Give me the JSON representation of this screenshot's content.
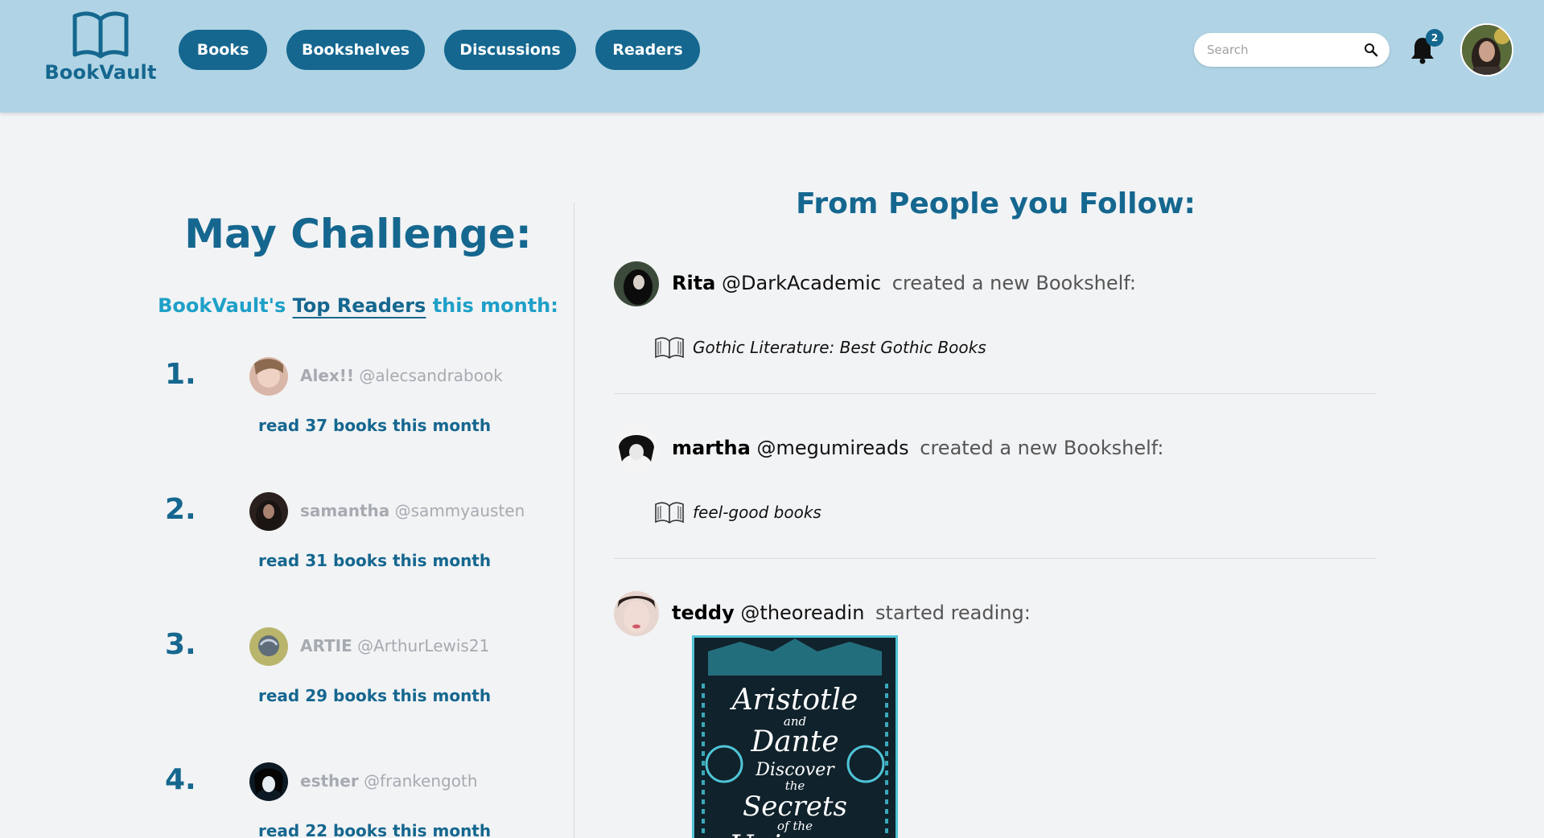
{
  "app": {
    "name": "BookVault",
    "colors": {
      "header_bg": "#b0d4e5",
      "primary": "#15678f",
      "accent": "#1ea0c8",
      "page_bg": "#f2f3f5"
    }
  },
  "nav": {
    "items": [
      {
        "label": "Books"
      },
      {
        "label": "Bookshelves"
      },
      {
        "label": "Discussions"
      },
      {
        "label": "Readers"
      }
    ]
  },
  "search": {
    "placeholder": "Search",
    "value": ""
  },
  "notifications": {
    "count": "2"
  },
  "challenge": {
    "title": "May Challenge:",
    "subtitle_prefix": "BookVault's",
    "subtitle_link": "Top Readers",
    "subtitle_suffix": "this month:",
    "rankings": [
      {
        "rank": "1.",
        "name": "Alex!!",
        "handle": "@alecsandrabook",
        "read_text": "read 37 books this month"
      },
      {
        "rank": "2.",
        "name": "samantha",
        "handle": "@sammyausten",
        "read_text": "read 31 books this month"
      },
      {
        "rank": "3.",
        "name": "ARTIE",
        "handle": "@ArthurLewis21",
        "read_text": "read 29 books this month"
      },
      {
        "rank": "4.",
        "name": "esther",
        "handle": "@frankengoth",
        "read_text": "read 22 books this month"
      }
    ]
  },
  "feed": {
    "title": "From People you Follow:",
    "items": [
      {
        "user": "Rita",
        "handle": "@DarkAcademic",
        "action": "created a new Bookshelf:",
        "shelf": "Gothic Literature: Best Gothic Books"
      },
      {
        "user": "martha",
        "handle": "@megumireads",
        "action": "created a new Bookshelf:",
        "shelf": "feel-good books"
      },
      {
        "user": "teddy",
        "handle": "@theoreadin",
        "action": "started reading:",
        "book_cover_text": [
          "Aristotle",
          "and",
          "Dante",
          "Discover",
          "the",
          "Secrets",
          "of the",
          "Universe"
        ]
      }
    ]
  }
}
